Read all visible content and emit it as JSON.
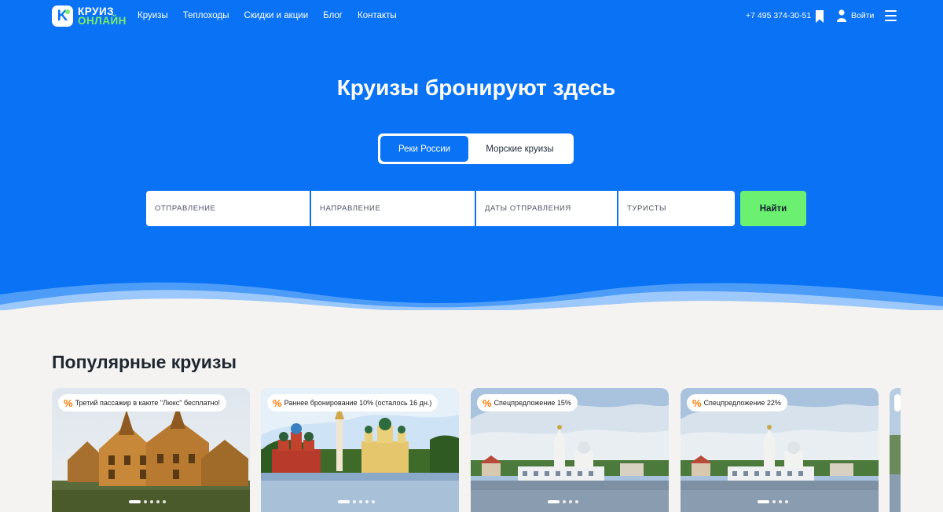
{
  "logo": {
    "line1": "КРУИЗ",
    "line2": "ОНЛАЙН",
    "mark": "K"
  },
  "nav": [
    "Круизы",
    "Теплоходы",
    "Скидки и акции",
    "Блог",
    "Контакты"
  ],
  "header": {
    "phone": "+7 495 374-30-51",
    "login": "Войти",
    "icons": [
      "bookmark-icon",
      "user-icon",
      "menu-icon"
    ]
  },
  "hero": {
    "title": "Круизы бронируют здесь"
  },
  "tabs": {
    "rivers": "Реки России",
    "sea": "Морские круизы",
    "selected": "Реки России"
  },
  "search": {
    "departure": "ОТПРАВЛЕНИЕ",
    "direction": "НАПРАВЛЕНИЕ",
    "dates": "ДАТЫ ОТПРАВЛЕНИЯ",
    "tourists": "ТУРИСТЫ",
    "submit": "Найти"
  },
  "popular": {
    "title": "Популярные круизы",
    "cards": [
      {
        "badge": "Третий пассажир в каюте \"Люкс\" бесплатно!",
        "badge_icon": "%"
      },
      {
        "badge": "Раннее бронирование 10% (осталось 16 дн.)",
        "badge_icon": "%"
      },
      {
        "badge": "Спецпредложение 15%",
        "badge_icon": "%"
      },
      {
        "badge": "Спецпредложение 22%",
        "badge_icon": "%"
      }
    ]
  },
  "colors": {
    "primary": "#0a73f5",
    "accent_green": "#6cf071",
    "logo_green": "#7aec6c",
    "badge_orange": "#ff7a00",
    "page_bg": "#f4f3f1"
  }
}
